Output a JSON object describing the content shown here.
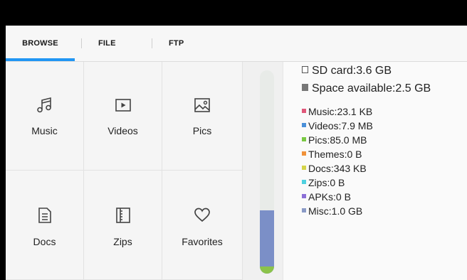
{
  "tabs": {
    "browse": "BROWSE",
    "file": "FILE",
    "ftp": "FTP",
    "active": "browse"
  },
  "categories": [
    {
      "label": "Music",
      "icon": "music-note-icon"
    },
    {
      "label": "Videos",
      "icon": "play-icon"
    },
    {
      "label": "Pics",
      "icon": "image-icon"
    },
    {
      "label": "Docs",
      "icon": "document-icon"
    },
    {
      "label": "Zips",
      "icon": "zip-icon"
    },
    {
      "label": "Favorites",
      "icon": "heart-icon"
    }
  ],
  "storage": {
    "sd_card": "SD card:3.6 GB",
    "space_available": "Space available:2.5 GB",
    "used_fraction": 0.31,
    "breakdown": [
      {
        "label": "Music:23.1 KB",
        "color": "#e0587a"
      },
      {
        "label": "Videos:7.9 MB",
        "color": "#4a90d9"
      },
      {
        "label": "Pics:85.0 MB",
        "color": "#7ac943"
      },
      {
        "label": "Themes:0 B",
        "color": "#f0923a"
      },
      {
        "label": "Docs:343 KB",
        "color": "#d4d44a"
      },
      {
        "label": "Zips:0 B",
        "color": "#4fd1e0"
      },
      {
        "label": "APKs:0 B",
        "color": "#8b6fd6"
      },
      {
        "label": "Misc:1.0 GB",
        "color": "#8a9ac6"
      }
    ]
  },
  "colors": {
    "accent": "#2196f3",
    "bar_fill": "#7b8fc7",
    "bar_tip": "#8bc34a"
  }
}
